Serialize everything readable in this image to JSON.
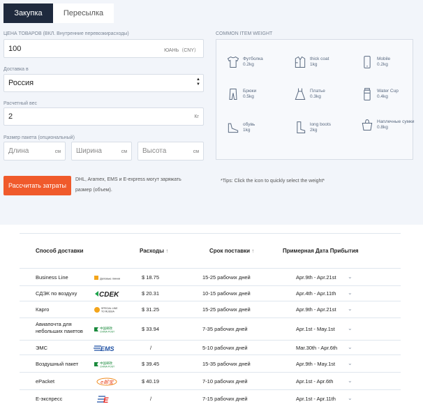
{
  "tabs": [
    {
      "label": "Закупка",
      "active": true
    },
    {
      "label": "Пересылка",
      "active": false
    }
  ],
  "price": {
    "label": "ЦЕНА ТОВАРОВ (ВКЛ. Внутренние  перевозкирасходы)",
    "value": "100",
    "unit": "ЮАНЬ（CNY）"
  },
  "destination": {
    "label": "Доставка в",
    "value": "Россия"
  },
  "weight": {
    "label": "Расчетный вес",
    "value": "2",
    "unit": "Кг"
  },
  "size": {
    "label": "Размер пакета (опциональный)",
    "length": {
      "placeholder": "Длина",
      "unit": "см"
    },
    "width": {
      "placeholder": "Ширина",
      "unit": "см"
    },
    "height": {
      "placeholder": "Высота",
      "unit": "см"
    }
  },
  "common_weight": {
    "title": "COMMON ITEM WEIGHT",
    "items": [
      {
        "name": "Футболка",
        "weight": "0.2kg",
        "icon": "tshirt-icon"
      },
      {
        "name": "thick coat",
        "weight": "1kg",
        "icon": "coat-icon"
      },
      {
        "name": "Mobile",
        "weight": "0.2kg",
        "icon": "mobile-icon"
      },
      {
        "name": "Брюки",
        "weight": "0.5kg",
        "icon": "pants-icon"
      },
      {
        "name": "Платье",
        "weight": "0.3kg",
        "icon": "dress-icon"
      },
      {
        "name": "Water Cup",
        "weight": "0.4kg",
        "icon": "cup-icon"
      },
      {
        "name": "обувь",
        "weight": "1kg",
        "icon": "shoe-icon"
      },
      {
        "name": "long boots",
        "weight": "2kg",
        "icon": "boots-icon"
      },
      {
        "name": "Наплечные сумки",
        "weight": "0.8kg",
        "icon": "bag-icon"
      }
    ]
  },
  "calculate_button": "Рассчитать затраты",
  "notice_line1": "DHL, Aramex, EMS и E-express могут заряжать",
  "notice_line2": "размер (объем).",
  "tips": "*Tips: Click the icon to quickly select the weight*",
  "table": {
    "headers": {
      "method": "Способ доставки",
      "cost": "Расходы",
      "term": "Срок поставки",
      "arrival": "Примерная Дата Прибытия"
    },
    "rows": [
      {
        "method": "Business Line",
        "cost": "$ 18.75",
        "term": "15-25 рабочих дней",
        "arrival": "Apr.9th - Apr.21st",
        "logo": "business-line-logo"
      },
      {
        "method": "СДЭК по воздуху",
        "cost": "$ 20.31",
        "term": "10-15 рабочих дней",
        "arrival": "Apr.4th - Apr.11th",
        "logo": "cdek-logo"
      },
      {
        "method": "Карго",
        "cost": "$ 31.25",
        "term": "15-25 рабочих дней",
        "arrival": "Apr.9th - Apr.21st",
        "logo": "special-line-logo"
      },
      {
        "method": "Авиапочта для небольших пакетов",
        "cost": "$ 33.94",
        "term": "7-35 рабочих дней",
        "arrival": "Apr.1st - May.1st",
        "logo": "china-post-logo"
      },
      {
        "method": "ЭМС",
        "cost": "/",
        "term": "5-10 рабочих дней",
        "arrival": "Mar.30th - Apr.6th",
        "logo": "ems-logo"
      },
      {
        "method": "Воздушный пакет",
        "cost": "$ 39.45",
        "term": "15-35 рабочих дней",
        "arrival": "Apr.9th - May.1st",
        "logo": "china-post-logo"
      },
      {
        "method": "ePacket",
        "cost": "$ 40.19",
        "term": "7-10 рабочих дней",
        "arrival": "Apr.1st - Apr.6th",
        "logo": "epacket-logo"
      },
      {
        "method": "E-экспресс",
        "cost": "/",
        "term": "7-15 рабочих дней",
        "arrival": "Apr.1st - Apr.11th",
        "logo": "e-express-logo"
      }
    ]
  },
  "logo_texts": {
    "cdek": "CDEK",
    "special": "SPECIAL LINE",
    "special2": "TO RUSSIA",
    "china_post": "中国邮政",
    "china_post2": "CHINA POST",
    "ems": "EMS",
    "epacket": "e邮宝",
    "e_express": "E",
    "business": "Деловые линии"
  },
  "colors": {
    "accent": "#f05a2b",
    "dark_tab": "#1f2a3e",
    "icon": "#5a6a80"
  }
}
